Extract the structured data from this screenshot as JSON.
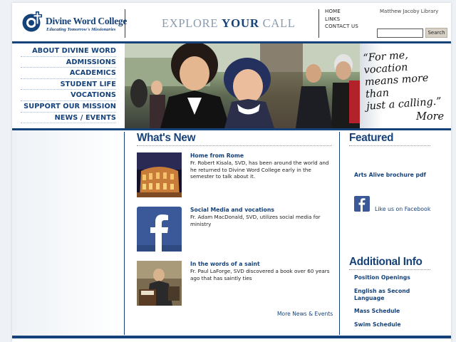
{
  "header": {
    "logo_name": "Divine Word College",
    "logo_tagline": "Educating Tomorrow's Missionaries",
    "tagline_pre": "EXPLORE",
    "tagline_strong": "YOUR",
    "tagline_post": "CALL",
    "top_links": [
      "HOME",
      "LINKS",
      "CONTACT US"
    ],
    "library_link": "Matthew Jacoby Library",
    "search_value": "",
    "search_button": "Search"
  },
  "nav": {
    "items": [
      "ABOUT DIVINE WORD",
      "ADMISSIONS",
      "ACADEMICS",
      "STUDENT LIFE",
      "VOCATIONS",
      "SUPPORT OUR MISSION",
      "NEWS / EVENTS"
    ]
  },
  "banner": {
    "quote_line1": "“For me, vocation",
    "quote_line2": "means more than",
    "quote_line3": "just a calling.”",
    "more_label": "More"
  },
  "whats_new": {
    "heading": "What's New",
    "items": [
      {
        "title": "Home from Rome",
        "description": "Fr. Robert Kisala, SVD, has been around the world and he returned to Divine Word College early in the semester to talk about it.",
        "thumb_icon": "colosseum-photo"
      },
      {
        "title": "Social Media and vocations",
        "description": "Fr. Adam MacDonald, SVD, utilizes social media for ministry",
        "thumb_icon": "facebook-logo"
      },
      {
        "title": "In the words of a saint",
        "description": "Fr. Paul LaForge, SVD discovered a book over 60 years ago that has saintly ties",
        "thumb_icon": "saint-painting"
      }
    ],
    "more_link": "More News & Events"
  },
  "featured": {
    "heading": "Featured",
    "brochure_link": "Arts Alive brochure pdf",
    "facebook_link": "Like us on Facebook"
  },
  "additional": {
    "heading": "Additional Info",
    "links": [
      "Position Openings",
      "English as Second Language",
      "Mass Schedule",
      "Swim Schedule"
    ]
  },
  "colors": {
    "brand_blue": "#16427a",
    "facebook_blue": "#3b5998",
    "muted_blue": "#8a9bb0"
  }
}
